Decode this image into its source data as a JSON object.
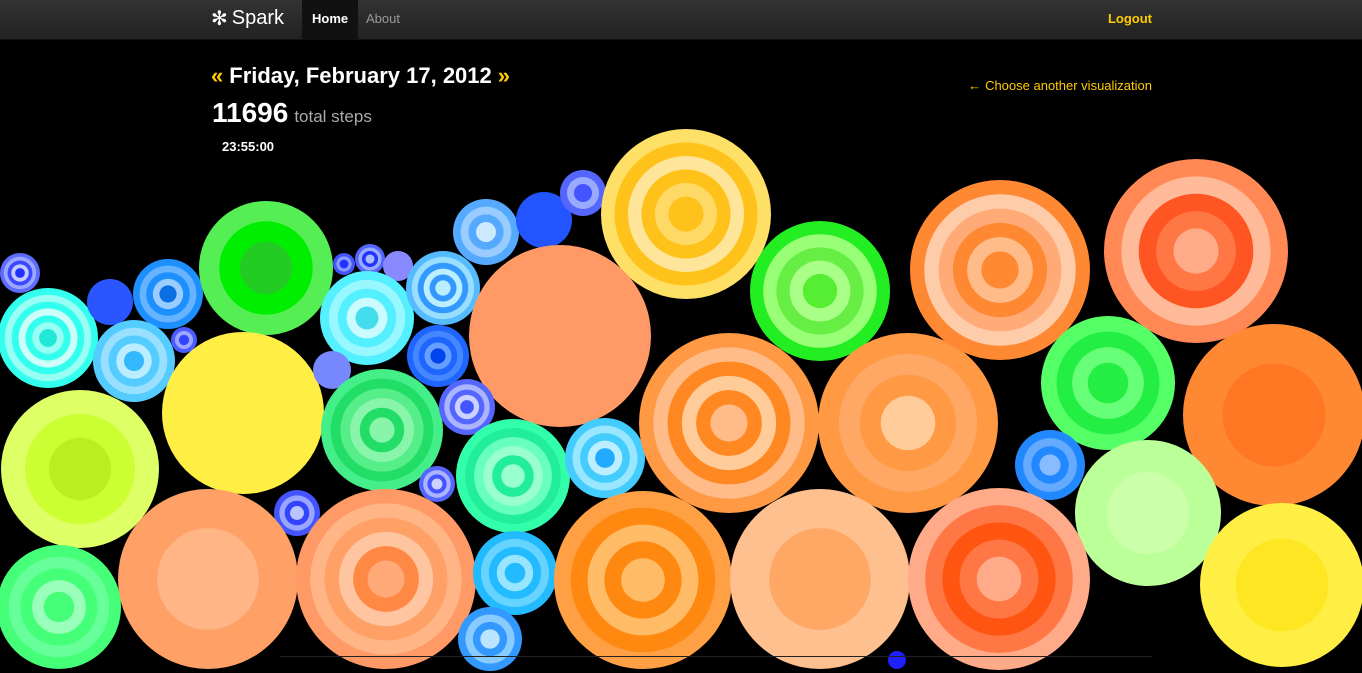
{
  "nav": {
    "brand": "Spark",
    "brand_icon": "asterisk-icon",
    "home": "Home",
    "about": "About",
    "logout": "Logout"
  },
  "header": {
    "prev_arrow": "«",
    "date": "Friday, February 17, 2012",
    "next_arrow": "»",
    "steps_count": "11696",
    "steps_label": "total steps",
    "time": "23:55:00",
    "choose_arrow": "←",
    "choose_label": "Choose another visualization"
  },
  "colors": {
    "accent": "#ffcc00",
    "navbar": "#2b2b2b",
    "background": "#000000"
  }
}
